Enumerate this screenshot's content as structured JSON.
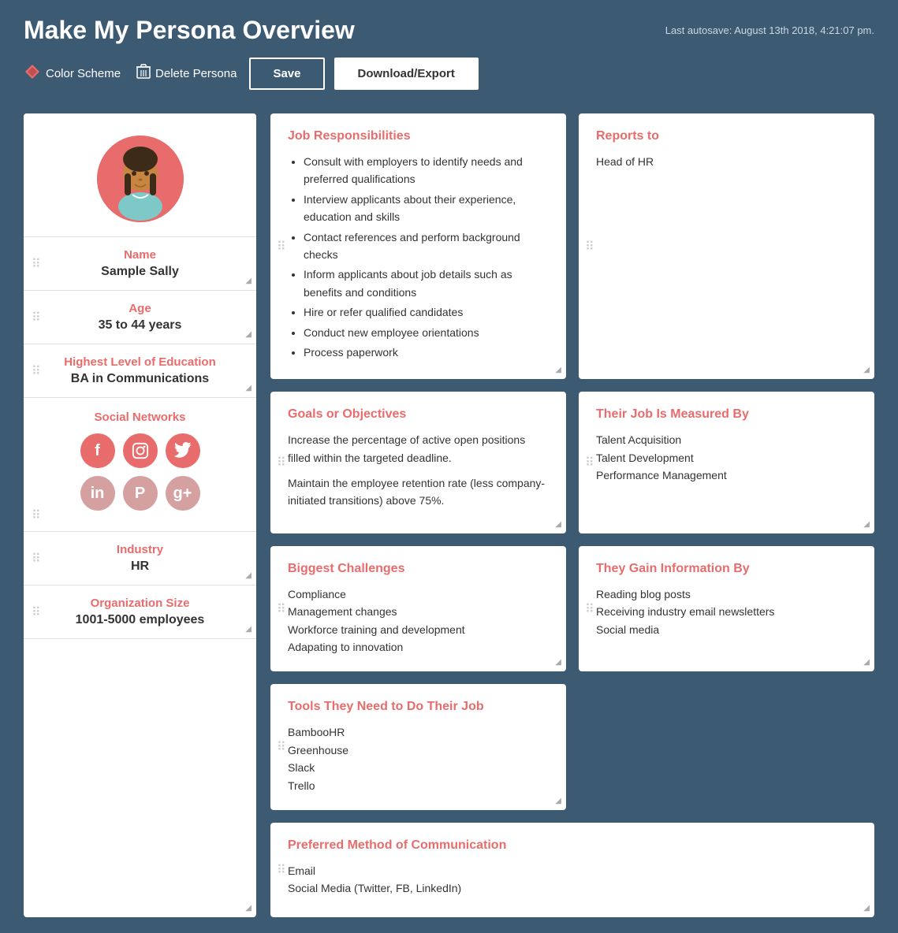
{
  "header": {
    "title": "Make My Persona Overview",
    "autosave": "Last autosave: August 13th 2018, 4:21:07 pm.",
    "color_scheme_label": "Color Scheme",
    "delete_persona_label": "Delete Persona",
    "save_label": "Save",
    "download_label": "Download/Export"
  },
  "left_panel": {
    "name_label": "Name",
    "name_value": "Sample Sally",
    "age_label": "Age",
    "age_value": "35 to 44 years",
    "education_label": "Highest Level of Education",
    "education_value": "BA in Communications",
    "social_label": "Social Networks",
    "industry_label": "Industry",
    "industry_value": "HR",
    "org_size_label": "Organization Size",
    "org_size_value": "1001-5000 employees"
  },
  "cards": {
    "job_responsibilities": {
      "title": "Job Responsibilities",
      "items": [
        "Consult with employers to identify needs and preferred qualifications",
        "Interview applicants about their experience, education and skills",
        "Contact references and perform background checks",
        "Inform applicants about job details such as benefits and conditions",
        "Hire or refer qualified candidates",
        "Conduct new employee orientations",
        "Process paperwork"
      ]
    },
    "reports_to": {
      "title": "Reports to",
      "value": "Head of HR"
    },
    "job_measured_by": {
      "title": "Their Job Is Measured By",
      "items": [
        "Talent Acquisition",
        "Talent Development",
        "Performance Management"
      ]
    },
    "goals": {
      "title": "Goals or Objectives",
      "paragraphs": [
        "Increase the percentage of active open positions filled within the targeted deadline.",
        "Maintain the employee retention rate (less company-initiated transitions) above 75%."
      ]
    },
    "challenges": {
      "title": "Biggest Challenges",
      "items": [
        "Compliance",
        "Management changes",
        "Workforce training and development",
        "Adapating to innovation"
      ]
    },
    "gain_info": {
      "title": "They Gain Information By",
      "items": [
        "Reading blog posts",
        "Receiving industry email newsletters",
        "Social media"
      ]
    },
    "tools": {
      "title": "Tools They Need to Do Their Job",
      "items": [
        "BambooHR",
        "Greenhouse",
        "Slack",
        "Trello"
      ]
    },
    "communication": {
      "title": "Preferred Method of Communication",
      "items": [
        "Email",
        "Social Media (Twitter, FB, LinkedIn)"
      ]
    }
  }
}
